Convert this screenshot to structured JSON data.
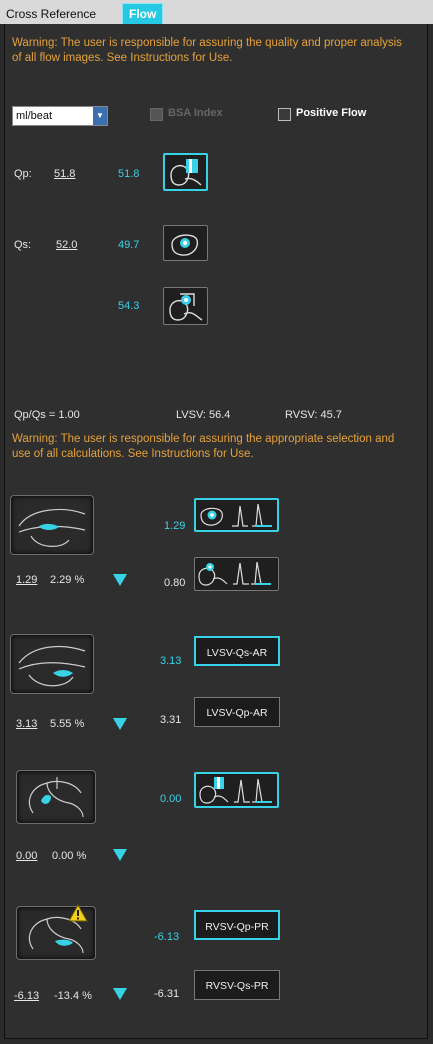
{
  "tabs": [
    {
      "label": "Cross Reference"
    },
    {
      "label": "Flow"
    }
  ],
  "warnings": {
    "top": "Warning: The user is responsible for assuring the quality and proper analysis of all flow images. See Instructions for Use.",
    "mid": "Warning: The user is responsible for assuring the appropriate selection and use of all calculations. See Instructions for Use."
  },
  "controls": {
    "unit_select": "ml/beat",
    "bsa_label": "BSA Index",
    "positive_flow_label": "Positive Flow"
  },
  "qp": {
    "label": "Qp:",
    "value": "51.8",
    "measured": "51.8"
  },
  "qs": {
    "label": "Qs:",
    "value": "52.0",
    "measured_1": "49.7",
    "measured_2": "54.3"
  },
  "summary": {
    "ratio": "Qp/Qs = 1.00",
    "lvsv": "LVSV: 56.4",
    "rvsv": "RVSV: 45.7"
  },
  "valves": [
    {
      "value": "1.29",
      "percent": "2.29 %",
      "top_value": "1.29",
      "bottom_value": "0.80"
    },
    {
      "value": "3.13",
      "percent": "5.55 %",
      "top_value": "3.13",
      "bottom_value": "3.31",
      "top_btn": "LVSV-Qs-AR",
      "bottom_btn": "LVSV-Qp-AR"
    },
    {
      "value": "0.00",
      "percent": "0.00 %",
      "top_value": "0.00"
    },
    {
      "value": "-6.13",
      "percent": "-13.4 %",
      "top_value": "-6.13",
      "bottom_value": "-6.31",
      "top_btn": "RVSV-Qp-PR",
      "bottom_btn": "RVSV-Qs-PR"
    }
  ],
  "colors": {
    "accent": "#37d2e6",
    "warning": "#e6a23a",
    "panel": "#2f2f2f"
  }
}
